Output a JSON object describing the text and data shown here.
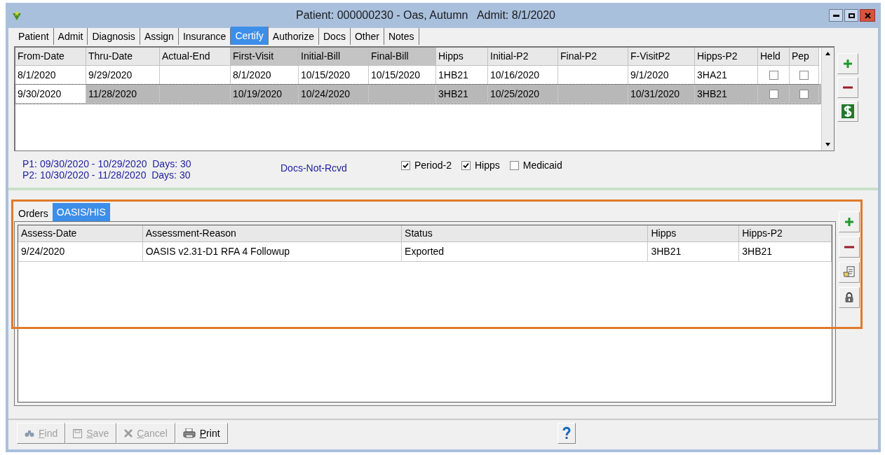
{
  "window": {
    "title": "Patient: 000000230 - Oas, Autumn   Admit: 8/1/2020"
  },
  "tabs": [
    {
      "label": "Patient",
      "selected": false
    },
    {
      "label": "Admit",
      "selected": false
    },
    {
      "label": "Diagnosis",
      "selected": false
    },
    {
      "label": "Assign",
      "selected": false
    },
    {
      "label": "Insurance",
      "selected": false
    },
    {
      "label": "Certify",
      "selected": true
    },
    {
      "label": "Authorize",
      "selected": false
    },
    {
      "label": "Docs",
      "selected": false
    },
    {
      "label": "Other",
      "selected": false
    },
    {
      "label": "Notes",
      "selected": false
    }
  ],
  "cert_table": {
    "columns": [
      {
        "label": "From-Date",
        "kind": "text",
        "shaded": false
      },
      {
        "label": "Thru-Date",
        "kind": "text",
        "shaded": false
      },
      {
        "label": "Actual-End",
        "kind": "text",
        "shaded": false
      },
      {
        "label": "First-Visit",
        "kind": "text",
        "shaded": true
      },
      {
        "label": "Initial-Bill",
        "kind": "text",
        "shaded": true
      },
      {
        "label": "Final-Bill",
        "kind": "text",
        "shaded": true
      },
      {
        "label": "Hipps",
        "kind": "text",
        "shaded": false
      },
      {
        "label": "Initial-P2",
        "kind": "text",
        "shaded": false
      },
      {
        "label": "Final-P2",
        "kind": "text",
        "shaded": false
      },
      {
        "label": "F-VisitP2",
        "kind": "text",
        "shaded": false
      },
      {
        "label": "Hipps-P2",
        "kind": "text",
        "shaded": false
      },
      {
        "label": "Held",
        "kind": "checkbox",
        "shaded": false
      },
      {
        "label": "Pep",
        "kind": "checkbox",
        "shaded": false
      }
    ],
    "rows": [
      {
        "selected": false,
        "cells": [
          "8/1/2020",
          "9/29/2020",
          "",
          "8/1/2020",
          "10/15/2020",
          "10/15/2020",
          "1HB21",
          "10/16/2020",
          "",
          "9/1/2020",
          "3HA21",
          {
            "checked": false
          },
          {
            "checked": false
          }
        ]
      },
      {
        "selected": true,
        "cells": [
          "9/30/2020",
          "11/28/2020",
          "",
          "10/19/2020",
          "10/24/2020",
          "",
          "3HB21",
          "10/25/2020",
          "",
          "10/31/2020",
          "3HB21",
          {
            "checked": false
          },
          {
            "checked": false
          }
        ]
      }
    ]
  },
  "periods": [
    "P1: 09/30/2020 - 10/29/2020  Days: 30",
    "P2: 10/30/2020 - 11/28/2020  Days: 30"
  ],
  "docs_status": "Docs-Not-Rcvd",
  "options": [
    {
      "label": "Period-2",
      "checked": true
    },
    {
      "label": "Hipps",
      "checked": true
    },
    {
      "label": "Medicaid",
      "checked": false
    }
  ],
  "sub_tabs": [
    {
      "label": "Orders",
      "selected": false
    },
    {
      "label": "OASIS/HIS",
      "selected": true
    }
  ],
  "assess_table": {
    "columns": [
      "Assess-Date",
      "Assessment-Reason",
      "Status",
      "Hipps",
      "Hipps-P2"
    ],
    "rows": [
      [
        "9/24/2020",
        "OASIS v2.31-D1 RFA 4 Followup",
        "Exported",
        "3HB21",
        "3HB21"
      ]
    ]
  },
  "toolbar": [
    {
      "label": "Find",
      "disabled": true
    },
    {
      "label": "Save",
      "disabled": true
    },
    {
      "label": "Cancel",
      "disabled": true
    },
    {
      "label": "Print",
      "disabled": false
    }
  ]
}
